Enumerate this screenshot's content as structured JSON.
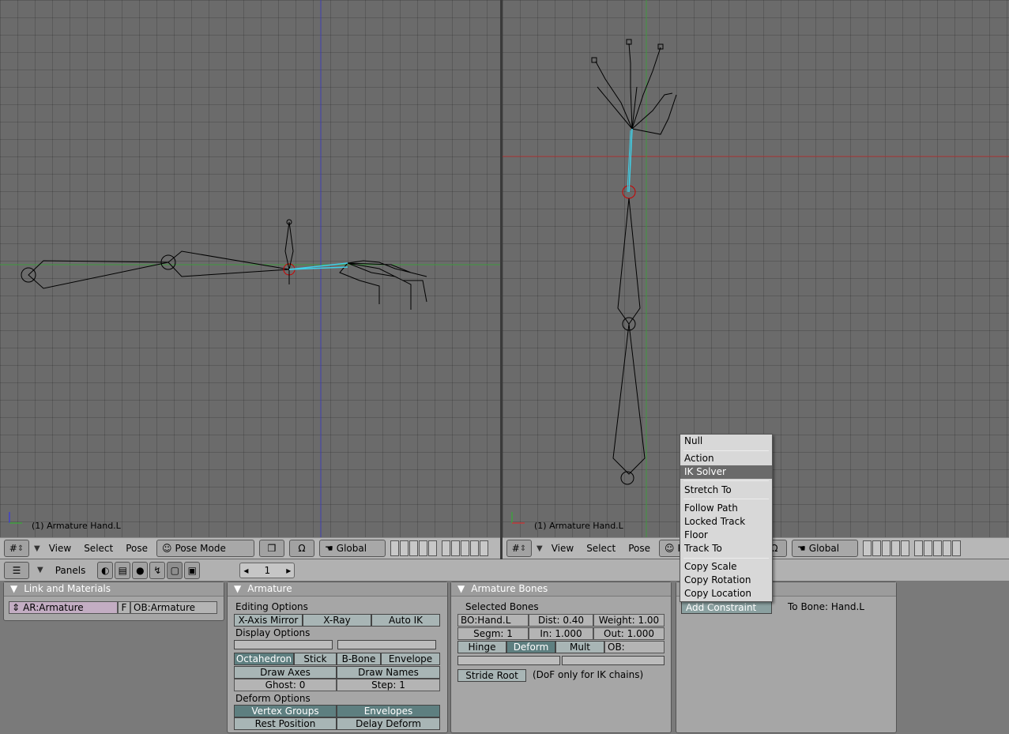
{
  "left_viewport": {
    "label": "(1) Armature Hand.L"
  },
  "right_viewport": {
    "label": "(1) Armature Hand.L"
  },
  "left_header": {
    "menus": [
      "View",
      "Select",
      "Pose"
    ],
    "mode": "Pose Mode",
    "orientation": "Global"
  },
  "right_header": {
    "menus": [
      "View",
      "Select",
      "Pose"
    ],
    "mode": "P",
    "orientation": "Global"
  },
  "buttons_header": {
    "panels_label": "Panels",
    "frame": "1"
  },
  "link_materials": {
    "title": "Link and Materials",
    "armature_field": "AR:Armature",
    "f_toggle": "F",
    "object_field": "OB:Armature"
  },
  "armature_panel": {
    "title": "Armature",
    "editing_options_label": "Editing Options",
    "x_axis_mirror": "X-Axis Mirror",
    "x_ray": "X-Ray",
    "auto_ik": "Auto IK",
    "display_options_label": "Display Options",
    "octahedron": "Octahedron",
    "stick": "Stick",
    "b_bone": "B-Bone",
    "envelope": "Envelope",
    "draw_axes": "Draw Axes",
    "draw_names": "Draw Names",
    "ghost": "Ghost: 0",
    "step": "Step: 1",
    "deform_options_label": "Deform Options",
    "vertex_groups": "Vertex Groups",
    "envelopes": "Envelopes",
    "rest_position": "Rest Position",
    "delay_deform": "Delay Deform"
  },
  "armature_bones": {
    "title": "Armature Bones",
    "selected_label": "Selected Bones",
    "bone_name": "BO:Hand.L",
    "dist": "Dist: 0.40",
    "weight": "Weight: 1.00",
    "segm": "Segm: 1",
    "in": "In: 1.000",
    "out": "Out: 1.000",
    "hinge": "Hinge",
    "deform": "Deform",
    "mult": "Mult",
    "ob_label": "OB:",
    "stride_root": "Stride Root",
    "dof_note": "(DoF only for IK chains)"
  },
  "constraints": {
    "add_constraint": "Add Constraint",
    "to_bone": "To Bone: Hand.L"
  },
  "constraint_menu": {
    "items": [
      "Null",
      "Action",
      "IK Solver",
      "Stretch To",
      "Follow Path",
      "Locked Track",
      "Floor",
      "Track To",
      "Copy Scale",
      "Copy Rotation",
      "Copy Location"
    ],
    "highlighted": "IK Solver"
  },
  "colors": {
    "viewport_bg": "#6b6b6b",
    "ik_bone": "#3fd0e8",
    "highlight": "#6a6a6a"
  }
}
